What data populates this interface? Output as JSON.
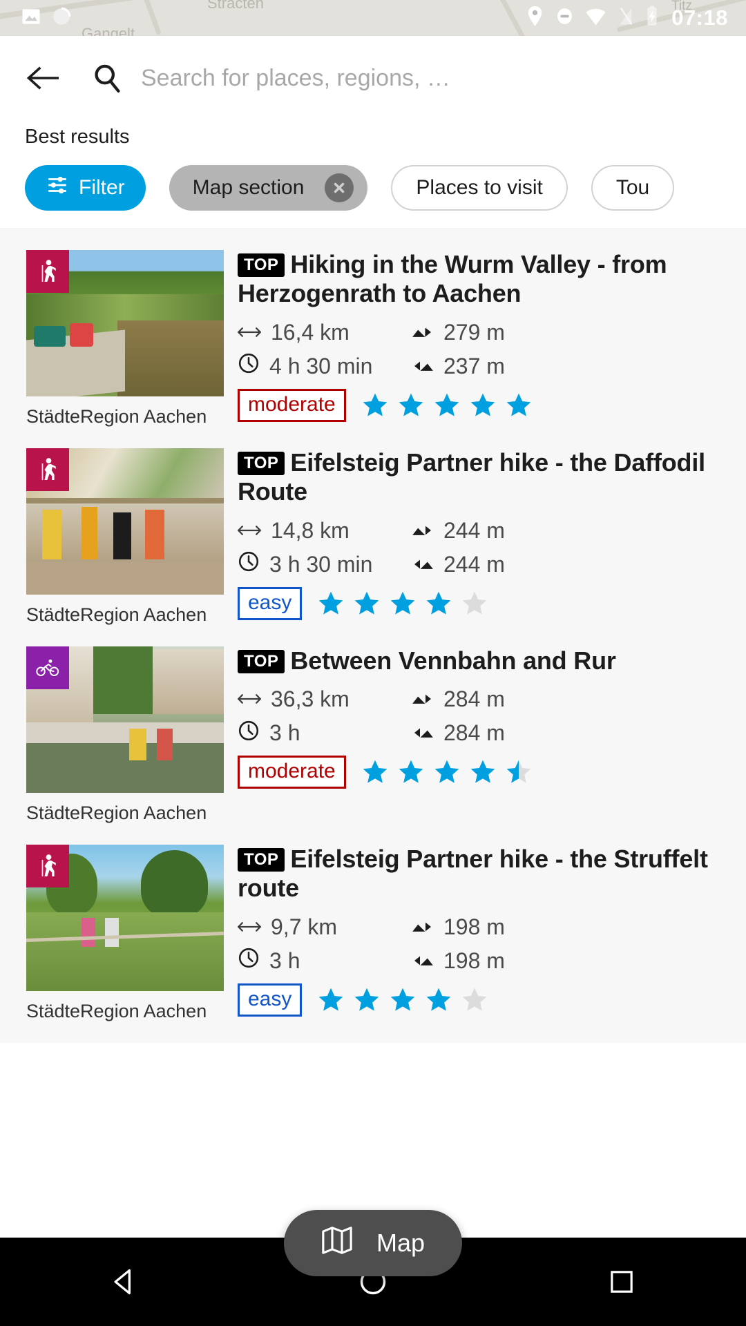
{
  "statusbar": {
    "time": "07:18",
    "icons": [
      "image-icon",
      "circle-progress-icon",
      "location-pin-icon",
      "do-not-disturb-icon",
      "wifi-icon",
      "signal-off-icon",
      "battery-charging-icon"
    ],
    "map_labels": [
      "Stracten",
      "Gangelt",
      "Titz"
    ]
  },
  "search": {
    "back_icon": "back-arrow-icon",
    "search_icon": "search-icon",
    "placeholder": "Search for places, regions, …",
    "value": ""
  },
  "results_header": {
    "title": "Best results"
  },
  "chips": [
    {
      "label": "Filter",
      "style": "filter",
      "icon": "filter-sliders-icon",
      "removable": false
    },
    {
      "label": "Map section",
      "style": "active",
      "icon": "",
      "removable": true
    },
    {
      "label": "Places to visit",
      "style": "outline",
      "icon": "",
      "removable": false
    },
    {
      "label": "Tou",
      "style": "outline",
      "icon": "",
      "removable": false
    }
  ],
  "results": [
    {
      "top": "TOP",
      "title": "Hiking in the Wurm Valley - from Herzogenrath to Aachen",
      "activity_icon": "hiking-icon",
      "activity_color": "#b8134a",
      "distance": "16,4 km",
      "duration": "4 h 30 min",
      "ascent": "279 m",
      "descent": "237 m",
      "difficulty": "moderate",
      "difficulty_style": "moderate",
      "rating": 5,
      "region": "StädteRegion Aachen"
    },
    {
      "top": "TOP",
      "title": "Eifelsteig Partner hike - the Daffodil Route",
      "activity_icon": "hiking-icon",
      "activity_color": "#b8134a",
      "distance": "14,8 km",
      "duration": "3 h 30 min",
      "ascent": "244 m",
      "descent": "244 m",
      "difficulty": "easy",
      "difficulty_style": "easy",
      "rating": 4,
      "region": "StädteRegion Aachen"
    },
    {
      "top": "TOP",
      "title": "Between Vennbahn and Rur",
      "activity_icon": "cycling-icon",
      "activity_color": "#8a21a8",
      "distance": "36,3 km",
      "duration": "3 h",
      "ascent": "284 m",
      "descent": "284 m",
      "difficulty": "moderate",
      "difficulty_style": "moderate",
      "rating": 4.5,
      "region": "StädteRegion Aachen"
    },
    {
      "top": "TOP",
      "title": "Eifelsteig Partner hike - the Struffelt route",
      "activity_icon": "hiking-icon",
      "activity_color": "#b8134a",
      "distance": "9,7 km",
      "duration": "3 h",
      "ascent": "198 m",
      "descent": "198 m",
      "difficulty": "easy",
      "difficulty_style": "easy",
      "rating": 4,
      "region": "StädteRegion Aachen"
    }
  ],
  "stat_icons": {
    "distance": "distance-arrows-icon",
    "duration": "clock-icon",
    "ascent": "ascent-icon",
    "descent": "descent-icon"
  },
  "map_fab": {
    "label": "Map",
    "icon": "map-icon"
  },
  "navbar": {
    "back": "nav-back-icon",
    "home": "nav-home-icon",
    "recents": "nav-recents-icon"
  },
  "colors": {
    "accent": "#00a0e0",
    "star": "#00a0e0",
    "star_empty": "#dcdcdc",
    "moderate": "#b00000",
    "easy": "#1155cc",
    "list_bg": "#f7f7f7"
  }
}
